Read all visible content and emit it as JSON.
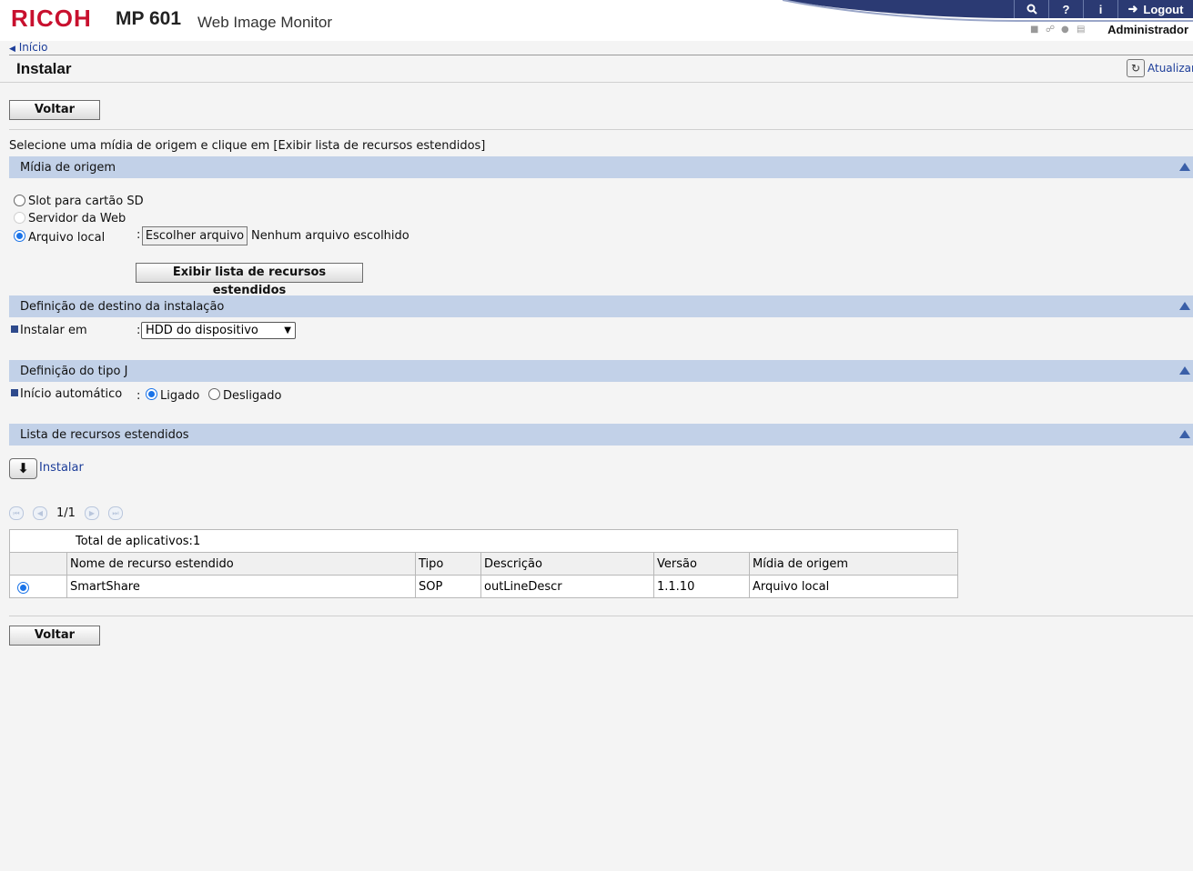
{
  "header": {
    "brand": "RICOH",
    "model": "MP 601",
    "product": "Web Image Monitor",
    "logout_label": "Logout",
    "user_label": "Administrador"
  },
  "breadcrumb": {
    "home_label": "Início"
  },
  "page": {
    "title": "Instalar",
    "refresh_label": "Atualizar",
    "back_label": "Voltar",
    "instruction": "Selecione uma mídia de origem e clique em [Exibir lista de recursos estendidos]"
  },
  "source_section": {
    "title": "Mídia de origem",
    "options": [
      "Slot para cartão SD",
      "Servidor da Web",
      "Arquivo local"
    ],
    "selected": "Arquivo local",
    "choose_file_label": "Escolher arquivo",
    "no_file_label": "Nenhum arquivo escolhido",
    "show_list_label": "Exibir lista de recursos estendidos"
  },
  "destination_section": {
    "title": "Definição de destino da instalação",
    "install_in_label": "Instalar em",
    "install_in_value": "HDD do dispositivo"
  },
  "type_section": {
    "title": "Definição do tipo J",
    "autostart_label": "Início automático",
    "on_label": "Ligado",
    "off_label": "Desligado",
    "selected": "Ligado"
  },
  "list_section": {
    "title": "Lista de recursos estendidos",
    "install_label": "Instalar",
    "page_indicator": "1/1",
    "total_label": "Total de aplicativos:1",
    "columns": [
      "Nome de recurso estendido",
      "Tipo",
      "Descrição",
      "Versão",
      "Mídia de origem"
    ],
    "rows": [
      {
        "name": "SmartShare",
        "type": "SOP",
        "description": "outLineDescr",
        "version": "1.1.10",
        "source": "Arquivo local"
      }
    ]
  },
  "colors": {
    "brand": "#c8102e",
    "nav_bar": "#2b3a73",
    "section_bar": "#c2d1e8",
    "link": "#1c3d99"
  }
}
